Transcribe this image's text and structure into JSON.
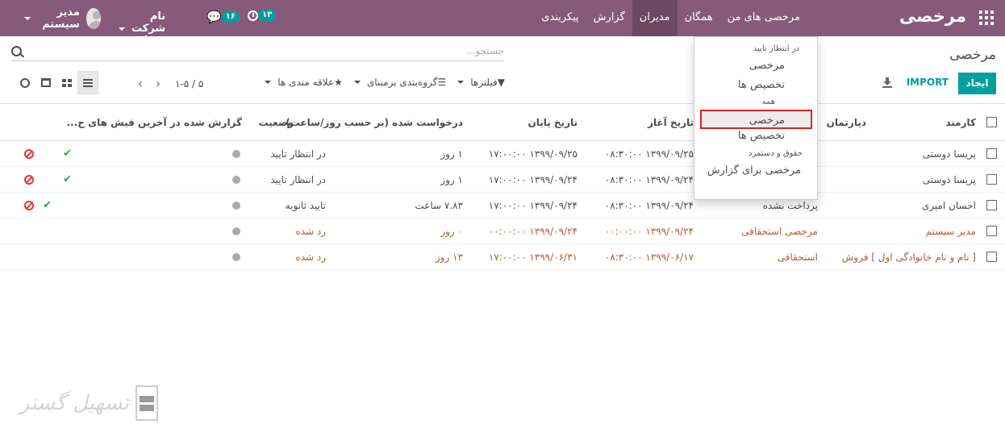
{
  "navbar": {
    "brand": "مرخصی",
    "menu": [
      "مرخصی های من",
      "همگان",
      "مدیران",
      "گزارش",
      "پیکربندی"
    ],
    "active_menu": "مدیران",
    "activity_count": "۱۳",
    "messages_count": "۱۶",
    "company": "نام شرکت شما",
    "user": "مدیر سیستم",
    "color": "#875a7b"
  },
  "control_panel": {
    "breadcrumb": "مرخصی",
    "search_placeholder": "جستجو...",
    "create_label": "ایجاد",
    "import_label": "IMPORT",
    "filters": [
      {
        "label": "فیلترها",
        "icon": "filter-icon"
      },
      {
        "label": "گروه‌بندی برمبنای",
        "icon": "bars-icon"
      },
      {
        "label": "علاقه مندی ها",
        "icon": "star-icon"
      }
    ],
    "pager": "۱-۵ / ۵",
    "accent": "#00a09d"
  },
  "table": {
    "headers": {
      "employee": "کارمند",
      "department": "دپارتمان",
      "start": "تاریخ آغاز",
      "end": "تاریخ پایان",
      "duration": "درخواست شده (بر حسب روز/ساعت)",
      "status": "وضعیت",
      "reported": "گزارش شده در آخرین فیش های ح..."
    },
    "rows": [
      {
        "employee": "پریسا دوستی",
        "department": "",
        "start": "۱۳۹۹/۰۹/۲۵ ۰۸:۳۰:۰۰",
        "end": "۱۳۹۹/۰۹/۲۵ ۱۷:۰۰:۰۰",
        "duration": "۱ روز",
        "status": "در انتظار تایید",
        "approve": true,
        "refuse": true
      },
      {
        "employee": "پریسا دوستی",
        "department": "",
        "start": "۱۳۹۹/۰۹/۲۴ ۰۸:۳۰:۰۰",
        "end": "۱۳۹۹/۰۹/۲۴ ۱۷:۰۰:۰۰",
        "duration": "۱ روز",
        "status": "در انتظار تایید",
        "approve": true,
        "refuse": true
      },
      {
        "employee": "احسان امیری",
        "department": "پرداخت نشده",
        "start": "۱۳۹۹/۰۹/۲۴ ۰۸:۳۰:۰۰",
        "end": "۱۳۹۹/۰۹/۲۴ ۱۷:۰۰:۰۰",
        "duration": "۷.۸۳ ساعت",
        "status": "تایید ثانویه",
        "approve": true,
        "refuse": true
      },
      {
        "employee": "مدیر سیستم",
        "department": "مرخصی استحقاقی",
        "start": "۱۳۹۹/۰۹/۲۴ ۰۰:۰۰:۰۰",
        "end": "۱۳۹۹/۰۹/۲۴ ۰۰:۰۰:۰۰",
        "duration": "۰ روز",
        "status": "رد شده",
        "approve": false,
        "refuse": false
      },
      {
        "employee": "[ نام و نام خانوادگی اول ]  فروش",
        "department": "استحقاقی",
        "start": "۱۳۹۹/۰۶/۱۷ ۰۸:۳۰:۰۰",
        "end": "۱۳۹۹/۰۶/۳۱ ۱۷:۰۰:۰۰",
        "duration": "۱۳ روز",
        "status": "رد شده",
        "approve": false,
        "refuse": false
      }
    ]
  },
  "dropdown": {
    "h1": "در انتظار تایید",
    "i1": "مرخصی",
    "i2": "تخصیص ها",
    "h2": "همه",
    "i3": "مرخصی",
    "i4": "تخصیص ها",
    "h3": "حقوق و دستمزد",
    "i5": "مرخصی برای گزارش"
  },
  "watermark": "تسهیل گستر"
}
